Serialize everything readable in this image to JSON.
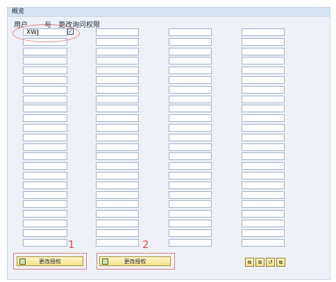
{
  "panel": {
    "title": "概览"
  },
  "headers": {
    "user": "用户",
    "and": "与",
    "change_query_permission": "更改询问权限"
  },
  "fields": {
    "col1_first_value": "XWJ"
  },
  "checkbox": {
    "checked": true,
    "mark": "✓"
  },
  "callouts": {
    "one": "1",
    "two": "2"
  },
  "buttons": {
    "change_auth_1": "更改授权",
    "change_auth_2": "更改授权"
  },
  "small_buttons": [
    "⧉",
    "⧉",
    "↺",
    "⧉"
  ],
  "colors": {
    "panel_bg": "#eef2f8",
    "field_border": "#9fb0c7",
    "highlight": "#e07b7b",
    "button": "#f3e18b"
  }
}
